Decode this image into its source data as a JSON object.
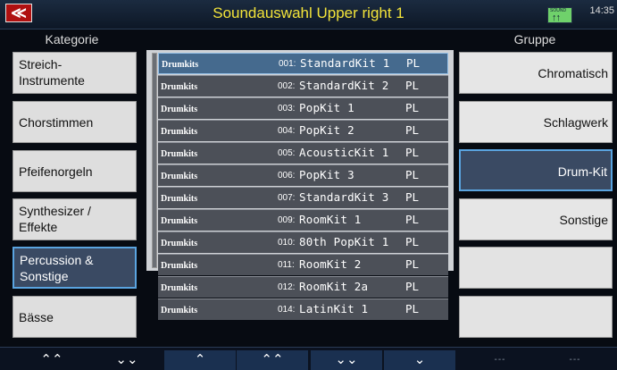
{
  "header": {
    "back_label": "≪",
    "title": "Soundauswahl Upper right 1",
    "status_icon_text": "↑↑",
    "status_icon_mini": "SOUND",
    "clock": "14:35"
  },
  "left": {
    "heading": "Kategorie",
    "categories": [
      {
        "label": "Streich-\nInstrumente",
        "selected": false
      },
      {
        "label": "Chorstimmen",
        "selected": false
      },
      {
        "label": "Pfeifenorgeln",
        "selected": false
      },
      {
        "label": "Synthesizer /\nEffekte",
        "selected": false
      },
      {
        "label": "Percussion &\nSonstige",
        "selected": true
      },
      {
        "label": "Bässe",
        "selected": false
      }
    ]
  },
  "list": {
    "rows": [
      {
        "group": "Drumkits",
        "number": "001:",
        "name": "StandardKit 1",
        "tag": "PL",
        "selected": true
      },
      {
        "group": "Drumkits",
        "number": "002:",
        "name": "StandardKit 2",
        "tag": "PL"
      },
      {
        "group": "Drumkits",
        "number": "003:",
        "name": "PopKit 1",
        "tag": "PL"
      },
      {
        "group": "Drumkits",
        "number": "004:",
        "name": "PopKit 2",
        "tag": "PL"
      },
      {
        "group": "Drumkits",
        "number": "005:",
        "name": "AcousticKit 1",
        "tag": "PL"
      },
      {
        "group": "Drumkits",
        "number": "006:",
        "name": "PopKit 3",
        "tag": "PL"
      },
      {
        "group": "Drumkits",
        "number": "007:",
        "name": "StandardKit 3",
        "tag": "PL"
      },
      {
        "group": "Drumkits",
        "number": "009:",
        "name": "RoomKit 1",
        "tag": "PL"
      },
      {
        "group": "Drumkits",
        "number": "010:",
        "name": "80th PopKit 1",
        "tag": "PL"
      },
      {
        "group": "Drumkits",
        "number": "011:",
        "name": "RoomKit 2",
        "tag": "PL"
      },
      {
        "group": "Drumkits",
        "number": "012:",
        "name": "RoomKit 2a",
        "tag": "PL"
      },
      {
        "group": "Drumkits",
        "number": "014:",
        "name": "LatinKit 1",
        "tag": "PL"
      }
    ]
  },
  "right": {
    "heading": "Gruppe",
    "groups": [
      {
        "label": "Chromatisch",
        "selected": false
      },
      {
        "label": "Schlagwerk",
        "selected": false
      },
      {
        "label": "Drum-Kit",
        "selected": true
      },
      {
        "label": "Sonstige",
        "selected": false
      },
      {
        "label": "",
        "selected": false
      },
      {
        "label": "",
        "selected": false
      }
    ]
  },
  "footer": {
    "buttons": [
      {
        "label": "«̂",
        "glyph": "⩓",
        "name": "category-page-up"
      },
      {
        "label": "⩔",
        "name": "category-page-down"
      },
      {
        "label": "⌅",
        "name": "list-top"
      },
      {
        "label": "⩓",
        "name": "list-page-up"
      },
      {
        "label": "⩔",
        "name": "list-page-down"
      },
      {
        "label": "⌄",
        "name": "list-bottom"
      },
      {
        "label": "---",
        "name": "empty-1"
      },
      {
        "label": "---",
        "name": "empty-2"
      }
    ]
  }
}
